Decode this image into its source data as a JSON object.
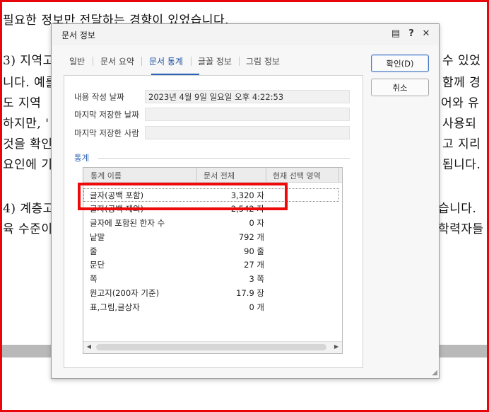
{
  "document": {
    "lines_left": [
      "필요한 정보만 전달하는 경향이 있었습니다.",
      "3) 지역고",
      "니다. 예를",
      "도 지역",
      "하지만, '",
      "것을 확인",
      "요인에 기",
      "4) 계층고",
      "육 수준이"
    ],
    "lines_right": [
      "수 있었",
      "함께 경",
      "어와 유",
      "사용되",
      "고 지리",
      "됩니다.",
      "습니다.",
      "학력자들"
    ]
  },
  "dialog": {
    "title": "문서 정보",
    "titlebar_icons": [
      "chat-icon",
      "help-icon",
      "close-icon"
    ],
    "titlebar_glyphs": [
      "▤",
      "?",
      "✕"
    ],
    "tabs": [
      {
        "label": "일반"
      },
      {
        "label": "문서 요약"
      },
      {
        "label": "문서 통계",
        "active": true
      },
      {
        "label": "글꼴 정보"
      },
      {
        "label": "그림 정보"
      }
    ],
    "fields": [
      {
        "label": "내용 작성 날짜",
        "value": "2023년 4월 9일 일요일 오후 4:22:53"
      },
      {
        "label": "마지막 저장한 날짜",
        "value": ""
      },
      {
        "label": "마지막 저장한 사람",
        "value": ""
      }
    ],
    "section_title": "통계",
    "columns": [
      "통계 이름",
      "문서 전체",
      "현재 선택 영역"
    ],
    "rows": [
      {
        "name": "글자(공백 포함)",
        "value": "3,320 자"
      },
      {
        "name": "글자(공백 제외)",
        "value": "2,542 자"
      },
      {
        "name": "글자에 포함된 한자 수",
        "value": "0 자"
      },
      {
        "name": "낱말",
        "value": "792 개"
      },
      {
        "name": "줄",
        "value": "90 줄"
      },
      {
        "name": "문단",
        "value": "27 개"
      },
      {
        "name": "쪽",
        "value": "3 쪽"
      },
      {
        "name": "원고지(200자 기준)",
        "value": "17.9 장"
      },
      {
        "name": "표,그림,글상자",
        "value": "0 개"
      }
    ],
    "buttons": {
      "ok": "확인(D)",
      "cancel": "취소"
    }
  },
  "colors": {
    "accent": "#2b62b5",
    "highlight_box": "#ee0a0a",
    "frame_border": "#e8060a"
  }
}
